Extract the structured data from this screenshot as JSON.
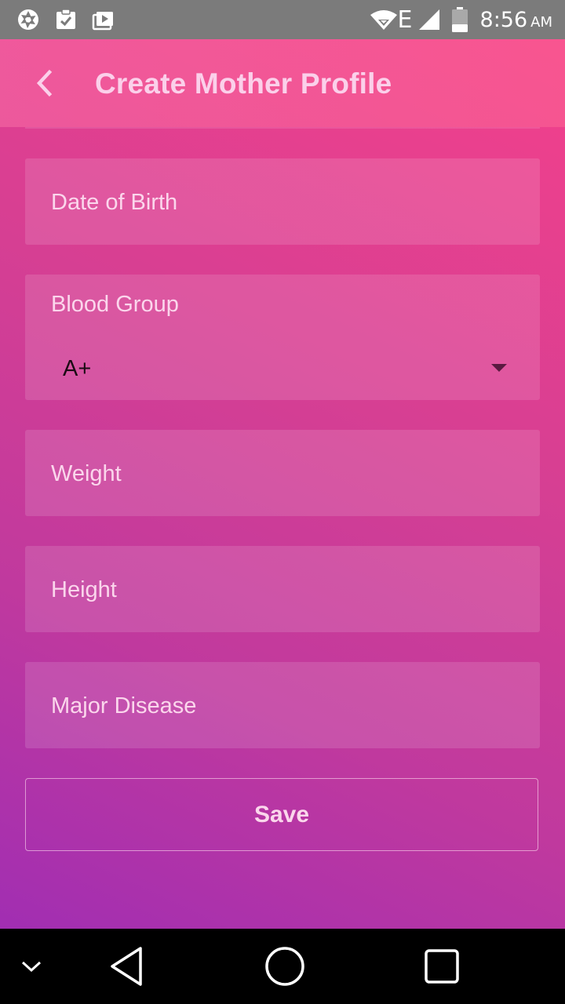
{
  "status_bar": {
    "time": "8:56",
    "ampm": "AM",
    "left_icons": [
      "camera-aperture-icon",
      "clipboard-check-icon",
      "media-play-icon"
    ],
    "right_icons": [
      "wifi-icon",
      "network-e-icon",
      "signal-icon",
      "battery-icon"
    ],
    "network_type": "E",
    "bar_color": "#7b7b7b"
  },
  "app_bar": {
    "title": "Create Mother Profile",
    "back_icon": "chevron-left-icon"
  },
  "form": {
    "date_of_birth": {
      "placeholder": "Date of Birth"
    },
    "blood_group": {
      "label": "Blood Group",
      "selected": "A+"
    },
    "weight": {
      "placeholder": "Weight"
    },
    "height": {
      "placeholder": "Height"
    },
    "major_disease": {
      "placeholder": "Major Disease"
    },
    "save_label": "Save"
  },
  "nav_bar": {
    "icons": [
      "chevron-down-icon",
      "back-triangle-icon",
      "home-circle-icon",
      "recents-square-icon"
    ]
  },
  "colors": {
    "gradient_top": "#f3408b",
    "gradient_bottom": "#a12eb2",
    "text_light": "#fbd6ec"
  }
}
